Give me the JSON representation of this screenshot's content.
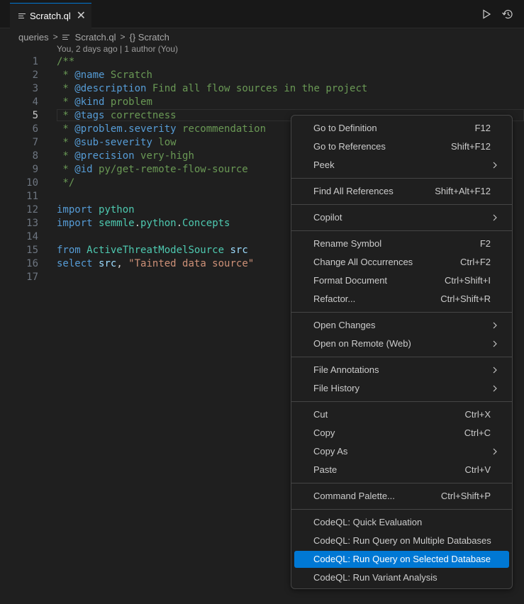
{
  "tab": {
    "title": "Scratch.ql"
  },
  "breadcrumb": {
    "folder": "queries",
    "file": "Scratch.ql",
    "symbol": "{} Scratch"
  },
  "blame": {
    "text": "You, 2 days ago | 1 author (You)"
  },
  "code": {
    "current_line": 5,
    "lines": [
      {
        "n": "1",
        "tokens": [
          {
            "t": "/**",
            "c": "c"
          }
        ]
      },
      {
        "n": "2",
        "tokens": [
          {
            "t": " * ",
            "c": "c"
          },
          {
            "t": "@name",
            "c": "tag"
          },
          {
            "t": " Scratch",
            "c": "c"
          }
        ]
      },
      {
        "n": "3",
        "tokens": [
          {
            "t": " * ",
            "c": "c"
          },
          {
            "t": "@description",
            "c": "tag"
          },
          {
            "t": " Find all flow sources in the project",
            "c": "c"
          }
        ]
      },
      {
        "n": "4",
        "tokens": [
          {
            "t": " * ",
            "c": "c"
          },
          {
            "t": "@kind",
            "c": "tag"
          },
          {
            "t": " problem",
            "c": "c"
          }
        ]
      },
      {
        "n": "5",
        "tokens": [
          {
            "t": " * ",
            "c": "c"
          },
          {
            "t": "@tags",
            "c": "tag"
          },
          {
            "t": " correctness",
            "c": "c"
          }
        ]
      },
      {
        "n": "6",
        "tokens": [
          {
            "t": " * ",
            "c": "c"
          },
          {
            "t": "@problem.severity",
            "c": "tag"
          },
          {
            "t": " recommendation",
            "c": "c"
          }
        ]
      },
      {
        "n": "7",
        "tokens": [
          {
            "t": " * ",
            "c": "c"
          },
          {
            "t": "@sub-severity",
            "c": "tag"
          },
          {
            "t": " low",
            "c": "c"
          }
        ]
      },
      {
        "n": "8",
        "tokens": [
          {
            "t": " * ",
            "c": "c"
          },
          {
            "t": "@precision",
            "c": "tag"
          },
          {
            "t": " very-high",
            "c": "c"
          }
        ]
      },
      {
        "n": "9",
        "tokens": [
          {
            "t": " * ",
            "c": "c"
          },
          {
            "t": "@id",
            "c": "tag"
          },
          {
            "t": " py/get-remote-flow-source",
            "c": "c"
          }
        ]
      },
      {
        "n": "10",
        "tokens": [
          {
            "t": " */",
            "c": "c"
          }
        ]
      },
      {
        "n": "11",
        "tokens": []
      },
      {
        "n": "12",
        "tokens": [
          {
            "t": "import",
            "c": "kw"
          },
          {
            "t": " ",
            "c": "plain"
          },
          {
            "t": "python",
            "c": "ty"
          }
        ]
      },
      {
        "n": "13",
        "tokens": [
          {
            "t": "import",
            "c": "kw"
          },
          {
            "t": " ",
            "c": "plain"
          },
          {
            "t": "semmle",
            "c": "ty"
          },
          {
            "t": ".",
            "c": "plain"
          },
          {
            "t": "python",
            "c": "ty"
          },
          {
            "t": ".",
            "c": "plain"
          },
          {
            "t": "Concepts",
            "c": "ty"
          }
        ]
      },
      {
        "n": "14",
        "tokens": []
      },
      {
        "n": "15",
        "tokens": [
          {
            "t": "from",
            "c": "kw"
          },
          {
            "t": " ",
            "c": "plain"
          },
          {
            "t": "ActiveThreatModelSource",
            "c": "ty"
          },
          {
            "t": " ",
            "c": "plain"
          },
          {
            "t": "src",
            "c": "id"
          }
        ]
      },
      {
        "n": "16",
        "tokens": [
          {
            "t": "select",
            "c": "kw"
          },
          {
            "t": " ",
            "c": "plain"
          },
          {
            "t": "src",
            "c": "id"
          },
          {
            "t": ", ",
            "c": "plain"
          },
          {
            "t": "\"Tainted data source\"",
            "c": "str"
          }
        ]
      },
      {
        "n": "17",
        "tokens": []
      }
    ]
  },
  "context_menu": {
    "groups": [
      [
        {
          "label": "Go to Definition",
          "shortcut": "F12"
        },
        {
          "label": "Go to References",
          "shortcut": "Shift+F12"
        },
        {
          "label": "Peek",
          "submenu": true
        }
      ],
      [
        {
          "label": "Find All References",
          "shortcut": "Shift+Alt+F12"
        }
      ],
      [
        {
          "label": "Copilot",
          "submenu": true
        }
      ],
      [
        {
          "label": "Rename Symbol",
          "shortcut": "F2"
        },
        {
          "label": "Change All Occurrences",
          "shortcut": "Ctrl+F2"
        },
        {
          "label": "Format Document",
          "shortcut": "Ctrl+Shift+I"
        },
        {
          "label": "Refactor...",
          "shortcut": "Ctrl+Shift+R"
        }
      ],
      [
        {
          "label": "Open Changes",
          "submenu": true
        },
        {
          "label": "Open on Remote (Web)",
          "submenu": true
        }
      ],
      [
        {
          "label": "File Annotations",
          "submenu": true
        },
        {
          "label": "File History",
          "submenu": true
        }
      ],
      [
        {
          "label": "Cut",
          "shortcut": "Ctrl+X"
        },
        {
          "label": "Copy",
          "shortcut": "Ctrl+C"
        },
        {
          "label": "Copy As",
          "submenu": true
        },
        {
          "label": "Paste",
          "shortcut": "Ctrl+V"
        }
      ],
      [
        {
          "label": "Command Palette...",
          "shortcut": "Ctrl+Shift+P"
        }
      ],
      [
        {
          "label": "CodeQL: Quick Evaluation"
        },
        {
          "label": "CodeQL: Run Query on Multiple Databases"
        },
        {
          "label": "CodeQL: Run Query on Selected Database",
          "selected": true
        },
        {
          "label": "CodeQL: Run Variant Analysis"
        }
      ]
    ]
  },
  "colors": {
    "accent": "#0078d4",
    "background": "#1f1f1f"
  },
  "icons": {
    "run": "play-icon",
    "history": "history-icon",
    "close": "close-icon",
    "chevron": "chevron-right-icon"
  }
}
